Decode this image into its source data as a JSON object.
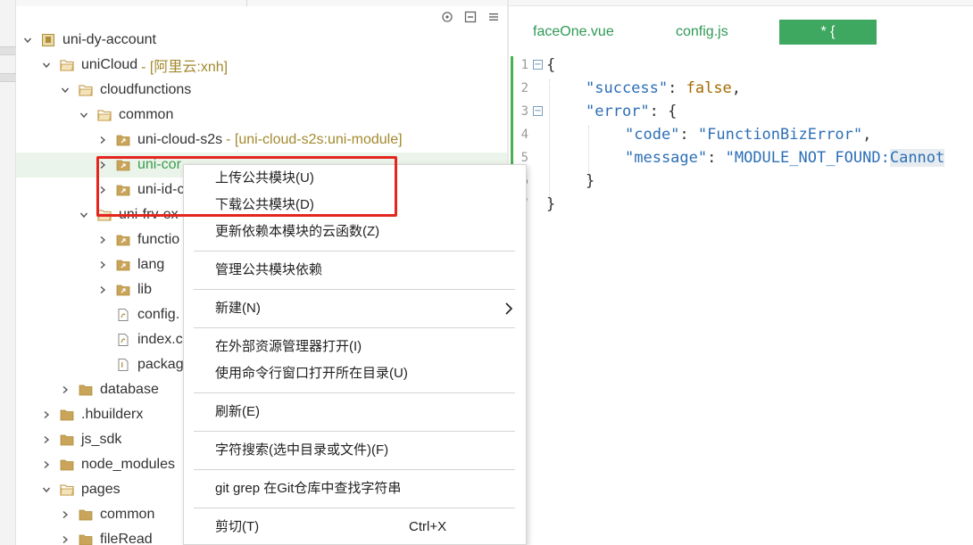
{
  "tree": {
    "toolbar": {
      "target_icon": "crosshair-icon",
      "collapse_icon": "collapse-icon",
      "menu_icon": "menu-icon"
    },
    "rows": [
      {
        "label": "uni-dy-account",
        "note": ""
      },
      {
        "label": "uniCloud",
        "note": "- [阿里云:xnh]"
      },
      {
        "label": "cloudfunctions",
        "note": ""
      },
      {
        "label": "common",
        "note": ""
      },
      {
        "label": "uni-cloud-s2s",
        "note": "- [uni-cloud-s2s:uni-module]"
      },
      {
        "label": "uni-cor",
        "note": ""
      },
      {
        "label": "uni-id-c",
        "note": ""
      },
      {
        "label": "uni-frv-ex",
        "note": ""
      },
      {
        "label": "functio",
        "note": ""
      },
      {
        "label": "lang",
        "note": ""
      },
      {
        "label": "lib",
        "note": ""
      },
      {
        "label": "config.",
        "note": ""
      },
      {
        "label": "index.c",
        "note": ""
      },
      {
        "label": "packag",
        "note": ""
      },
      {
        "label": "database",
        "note": ""
      },
      {
        "label": ".hbuilderx",
        "note": ""
      },
      {
        "label": "js_sdk",
        "note": ""
      },
      {
        "label": "node_modules",
        "note": ""
      },
      {
        "label": "pages",
        "note": ""
      },
      {
        "label": "common",
        "note": ""
      },
      {
        "label": "fileRead",
        "note": ""
      }
    ]
  },
  "editor": {
    "tabs": [
      {
        "label": "faceOne.vue"
      },
      {
        "label": "config.js"
      },
      {
        "label": "* {"
      }
    ],
    "lines": [
      {
        "num": "1",
        "parts": [
          "{"
        ]
      },
      {
        "num": "2",
        "parts": [
          "\"success\"",
          ": ",
          "false",
          ","
        ]
      },
      {
        "num": "3",
        "parts": [
          "\"error\"",
          ": {"
        ]
      },
      {
        "num": "4",
        "parts": [
          "\"code\"",
          ": ",
          "\"FunctionBizError\"",
          ","
        ]
      },
      {
        "num": "5",
        "parts": [
          "\"message\"",
          ": ",
          "\"MODULE_NOT_FOUND:",
          "Cannot"
        ]
      },
      {
        "num": "6",
        "parts": [
          "}"
        ]
      },
      {
        "num": "7",
        "parts": [
          "}"
        ]
      }
    ]
  },
  "context_menu": {
    "items": [
      {
        "label": "上传公共模块(U)"
      },
      {
        "label": "下载公共模块(D)"
      },
      {
        "label": "更新依赖本模块的云函数(Z)"
      },
      {
        "label": "管理公共模块依赖"
      },
      {
        "label": "新建(N)"
      },
      {
        "label": "在外部资源管理器打开(I)"
      },
      {
        "label": "使用命令行窗口打开所在目录(U)"
      },
      {
        "label": "刷新(E)"
      },
      {
        "label": "字符搜索(选中目录或文件)(F)"
      },
      {
        "label": "git grep 在Git仓库中查找字符串"
      },
      {
        "label": "剪切(T)",
        "shortcut": "Ctrl+X"
      }
    ]
  },
  "colors": {
    "accent_green": "#3fa860",
    "note_gold": "#a38a2f",
    "highlight_red": "#e4261f",
    "folder": "#c9a45a"
  }
}
